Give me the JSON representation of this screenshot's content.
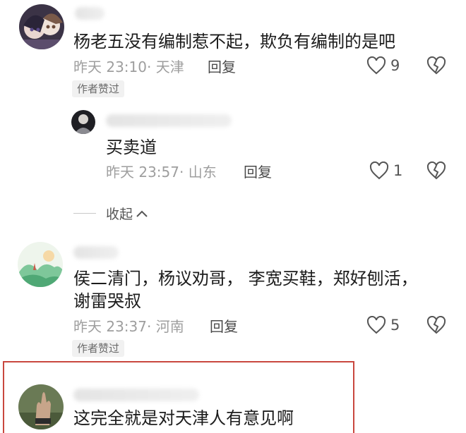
{
  "comments": [
    {
      "text": "杨老五没有编制惹不起，欺负有编制的是吧",
      "time": "昨天 23:10",
      "location": "天津",
      "reply_label": "回复",
      "like_count": "9",
      "badge": "作者赞过"
    },
    {
      "text": "侯二清门，杨议劝哥，  李宽买鞋，郑好刨活，",
      "text2": "谢雷哭叔",
      "time": "昨天 23:37",
      "location": "河南",
      "reply_label": "回复",
      "like_count": "5",
      "badge": "作者赞过"
    },
    {
      "text": "这完全就是对天津人有意见啊"
    }
  ],
  "reply": {
    "text": "买卖道",
    "time": "昨天 23:57",
    "location": "山东",
    "reply_label": "回复",
    "like_count": "1"
  },
  "collapse_label": "收起",
  "colors": {
    "highlight_border": "#c9473e",
    "meta": "#9e9e9e"
  },
  "icons": [
    "heart-outline-icon",
    "broken-heart-icon",
    "chevron-up-icon"
  ]
}
